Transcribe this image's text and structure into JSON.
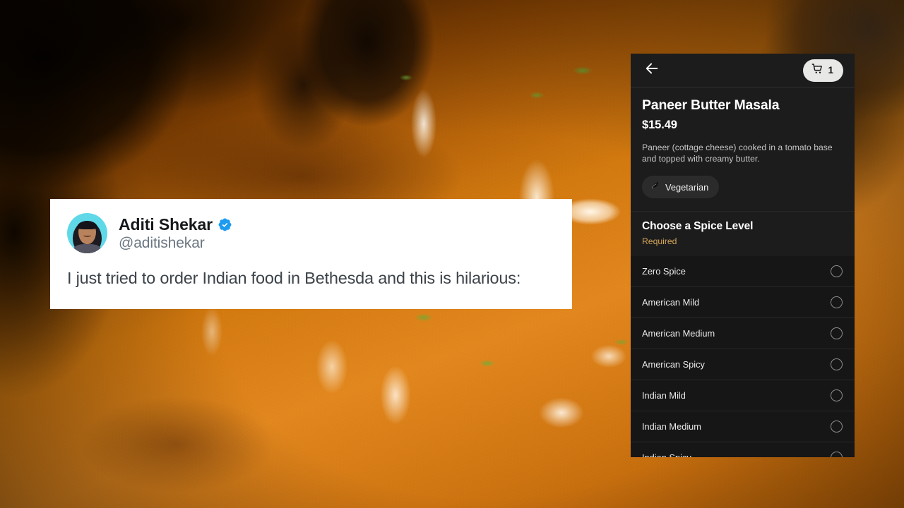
{
  "background": {
    "description": "close-up photo of paneer butter masala curry in a dark pan with cream swirls and cilantro",
    "accent_color": "#c97a1c"
  },
  "tweet": {
    "display_name": "Aditi Shekar",
    "handle": "@aditishekar",
    "verified_badge": "verified-badge-icon",
    "text": "I just tried to order Indian food in Bethesda and this is hilarious:",
    "avatar_alt": "profile photo of Aditi Shekar",
    "card_background": "#ffffff",
    "verified_color": "#1d9bf0"
  },
  "panel": {
    "header": {
      "back_icon": "arrow-left-icon",
      "cart_icon": "shopping-cart-icon",
      "cart_count": "1"
    },
    "item": {
      "title": "Paneer Butter Masala",
      "price": "$15.49",
      "description": "Paneer (cottage cheese) cooked in a tomato base and topped with creamy butter.",
      "tags": [
        {
          "label": "Vegetarian",
          "icon": "leaf-icon"
        }
      ]
    },
    "option_group": {
      "title": "Choose a Spice Level",
      "required_label": "Required",
      "required_color": "#d6a75b",
      "options": [
        {
          "label": "Zero Spice",
          "selected": false
        },
        {
          "label": "American Mild",
          "selected": false
        },
        {
          "label": "American Medium",
          "selected": false
        },
        {
          "label": "American Spicy",
          "selected": false
        },
        {
          "label": "Indian Mild",
          "selected": false
        },
        {
          "label": "Indian Medium",
          "selected": false
        },
        {
          "label": "Indian Spicy",
          "selected": false
        },
        {
          "label": "",
          "selected": false
        }
      ]
    },
    "colors": {
      "panel_bg": "#141414",
      "header_bg": "#1c1c1c",
      "option_bg": "#161616",
      "divider": "#272727"
    }
  }
}
